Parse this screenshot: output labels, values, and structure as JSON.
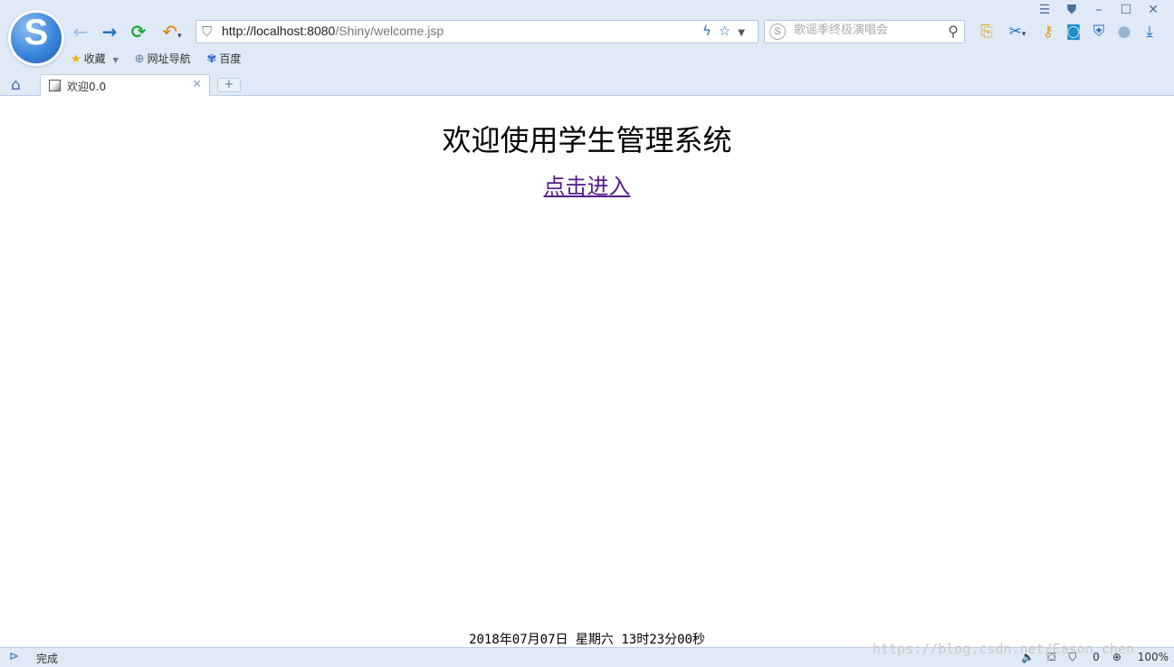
{
  "browser": {
    "url_host": "http://localhost:8080",
    "url_path": "/Shiny/welcome.jsp",
    "search_placeholder": "歌谣季终极演唱会",
    "bookmarks": [
      "收藏",
      "网址导航",
      "百度"
    ],
    "tab_title": "欢迎0.0",
    "new_tab": "+",
    "status_text": "完成",
    "watermark": "https://blog.csdn.net/Eason_chen",
    "status_count": "0",
    "zoom": "100%",
    "colors": {
      "chrome_bg": "#dfeaf6",
      "link_visited": "#551a8b",
      "forward_arrow": "#1e6fc0",
      "refresh": "#26a843",
      "undo": "#e07a00"
    }
  },
  "page": {
    "heading": "欢迎使用学生管理系统",
    "enter_link": "点击进入",
    "datetime": "2018年07月07日 星期六 13时23分00秒"
  }
}
